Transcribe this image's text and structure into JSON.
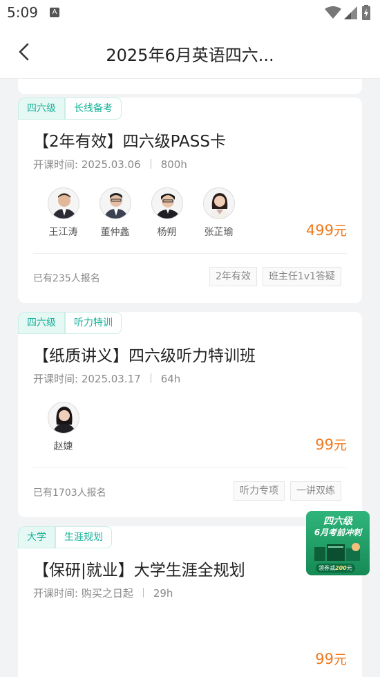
{
  "status_bar": {
    "time": "5:09",
    "notification_icon": "A"
  },
  "header": {
    "title": "2025年6月英语四六..."
  },
  "courses": [
    {
      "tags": [
        "四六级",
        "长线备考"
      ],
      "title": "【2年有效】四六级PASS卡",
      "start_label": "开课时间: 2025.03.06",
      "duration": "800h",
      "teachers": [
        "王江涛",
        "董仲蠡",
        "杨朔",
        "张芷瑜"
      ],
      "price": "499",
      "price_unit": "元",
      "enrolled": "已有235人报名",
      "features": [
        "2年有效",
        "班主任1v1答疑"
      ]
    },
    {
      "tags": [
        "四六级",
        "听力特训"
      ],
      "title": "【纸质讲义】四六级听力特训班",
      "start_label": "开课时间: 2025.03.17",
      "duration": "64h",
      "teachers": [
        "赵婕"
      ],
      "price": "99",
      "price_unit": "元",
      "enrolled": "已有1703人报名",
      "features": [
        "听力专项",
        "一讲双练"
      ]
    },
    {
      "tags": [
        "大学",
        "生涯规划"
      ],
      "title": "【保研|就业】大学生涯全规划",
      "start_label": "开课时间: 购买之日起",
      "duration": "29h",
      "price": "99",
      "price_unit": "元"
    }
  ],
  "promo_badge": {
    "line1": "四六级",
    "line2": "6月考前冲刺",
    "line3_prefix": "领券减",
    "line3_amount": "200",
    "line3_unit": "元"
  },
  "colors": {
    "accent": "#17b29a",
    "price": "#f07a1f",
    "promo_green": "#1e9a62"
  }
}
